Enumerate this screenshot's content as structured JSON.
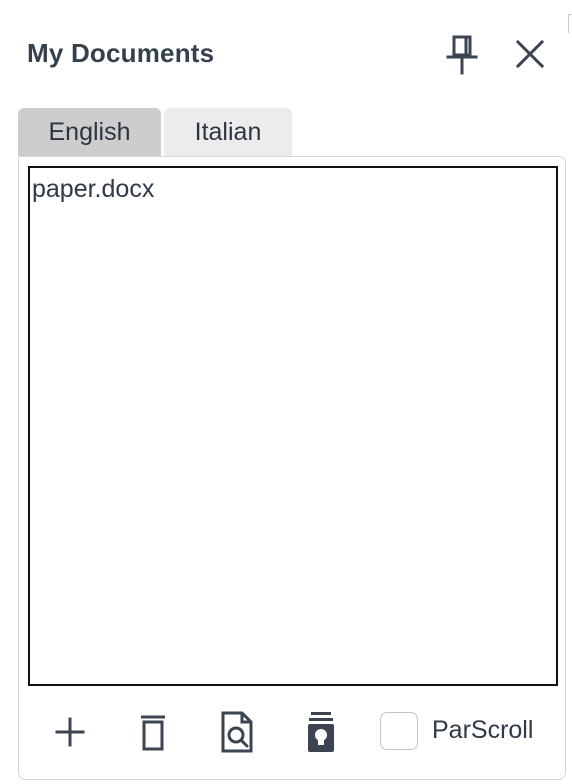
{
  "panel": {
    "title": "My Documents"
  },
  "header_icons": {
    "pin": "pin-icon",
    "close": "close-icon"
  },
  "tabs": [
    {
      "label": "English",
      "active": true
    },
    {
      "label": "Italian",
      "active": false
    }
  ],
  "documents": [
    {
      "name": "paper.docx"
    }
  ],
  "toolbar": {
    "add_icon": "plus-icon",
    "delete_icon": "trash-icon",
    "preview_icon": "document-search-icon",
    "hint_icon": "lightbulb-icon",
    "parscroll_label": "ParScroll",
    "parscroll_checked": false
  },
  "colors": {
    "text": "#2e3a47",
    "tab_active": "#cdcdcd",
    "tab_inactive": "#ececec",
    "list_border": "#111111"
  }
}
